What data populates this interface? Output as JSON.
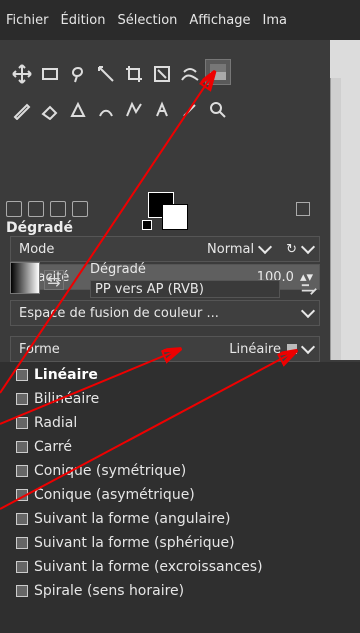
{
  "menubar": {
    "items": [
      "Fichier",
      "Édition",
      "Sélection",
      "Affichage",
      "Ima"
    ]
  },
  "tool_options": {
    "title": "Dégradé",
    "mode_label": "Mode",
    "mode_value": "Normal",
    "opacity_label": "Opacité",
    "opacity_value": "100.0",
    "gradient_label": "Dégradé",
    "gradient_name": "PP vers AP (RVB)",
    "blend_space_label": "Espace de fusion de couleur ...",
    "shape_label": "Forme",
    "shape_value": "Linéaire"
  },
  "shape_options": [
    "Linéaire",
    "Bilinéaire",
    "Radial",
    "Carré",
    "Conique (symétrique)",
    "Conique (asymétrique)",
    "Suivant la forme (angulaire)",
    "Suivant la forme (sphérique)",
    "Suivant la forme (excroissances)",
    "Spirale (sens horaire)"
  ],
  "colors": {
    "ui_bg": "#3b3b3b",
    "menu_bg": "#2b2b2b",
    "dropdown_bg": "#2f2f2f",
    "annotation_arrow": "#e00000"
  }
}
